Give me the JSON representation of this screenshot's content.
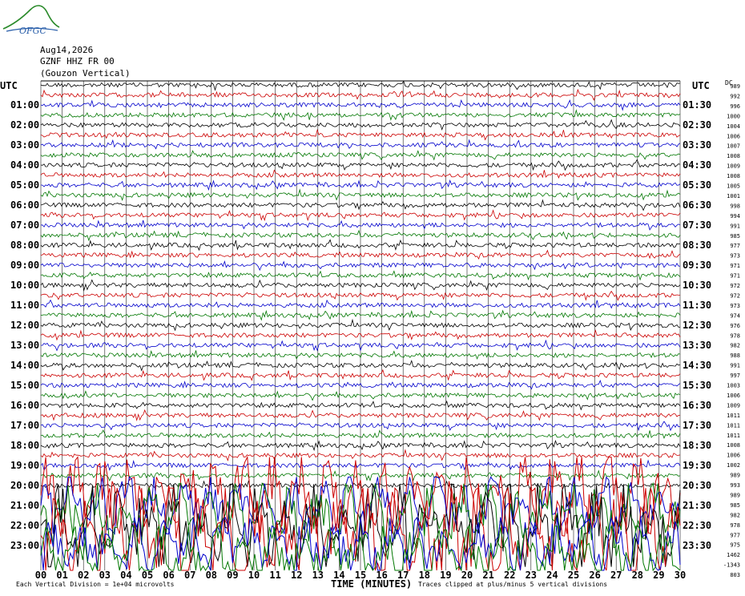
{
  "header": {
    "date": "Aug14,2026",
    "station": "GZNF HHZ FR 00",
    "location": "(Gouzon Vertical)",
    "logo_text": "OFGC"
  },
  "axis": {
    "left_label": "UTC",
    "right_label": "UTC",
    "dc_label": "DC",
    "xlabel": "TIME (MINUTES)"
  },
  "footer": {
    "left": "Each Vertical Division = 1e+04 microvolts",
    "right": "Traces clipped at plus/minus 5 vertical divisions"
  },
  "colors": {
    "trace_cycle": [
      "#000000",
      "#cc0000",
      "#0000cc",
      "#007700"
    ],
    "grid": "#000000",
    "logo": "#2a8a2a"
  },
  "chart_data": {
    "type": "line",
    "description_kind": "helicorder",
    "x": {
      "min": 0,
      "max": 30,
      "ticks": [
        "00",
        "01",
        "02",
        "03",
        "04",
        "05",
        "06",
        "07",
        "08",
        "09",
        "10",
        "11",
        "12",
        "13",
        "14",
        "15",
        "16",
        "17",
        "18",
        "19",
        "20",
        "21",
        "22",
        "23",
        "24",
        "25",
        "26",
        "27",
        "28",
        "29",
        "30"
      ]
    },
    "left_hour_labels": [
      "01:00",
      "02:00",
      "03:00",
      "04:00",
      "05:00",
      "06:00",
      "07:00",
      "08:00",
      "09:00",
      "10:00",
      "11:00",
      "12:00",
      "13:00",
      "14:00",
      "15:00",
      "16:00",
      "17:00",
      "18:00",
      "19:00",
      "20:00",
      "21:00",
      "22:00",
      "23:00"
    ],
    "right_hour_labels": [
      "01:30",
      "02:30",
      "03:30",
      "04:30",
      "05:30",
      "06:30",
      "07:30",
      "08:30",
      "09:30",
      "10:30",
      "11:30",
      "12:30",
      "13:30",
      "14:30",
      "15:30",
      "16:30",
      "17:30",
      "18:30",
      "19:30",
      "20:30",
      "21:30",
      "22:30",
      "23:30"
    ],
    "dc_offsets": [
      "989",
      "992",
      "996",
      "1000",
      "1004",
      "1006",
      "1007",
      "1008",
      "1009",
      "1008",
      "1005",
      "1001",
      "998",
      "994",
      "991",
      "985",
      "977",
      "973",
      "971",
      "971",
      "972",
      "972",
      "973",
      "974",
      "976",
      "978",
      "982",
      "988",
      "991",
      "997",
      "1003",
      "1006",
      "1009",
      "1011",
      "1011",
      "1011",
      "1008",
      "1006",
      "1002",
      "989",
      "993",
      "989",
      "985",
      "982",
      "978",
      "977",
      "975",
      "1462",
      "-1343",
      "803"
    ],
    "trace_count": 48,
    "quiet_amplitude": 0.12,
    "active_from_trace": 41,
    "active_amplitude": 5,
    "clip_divisions": 5
  }
}
